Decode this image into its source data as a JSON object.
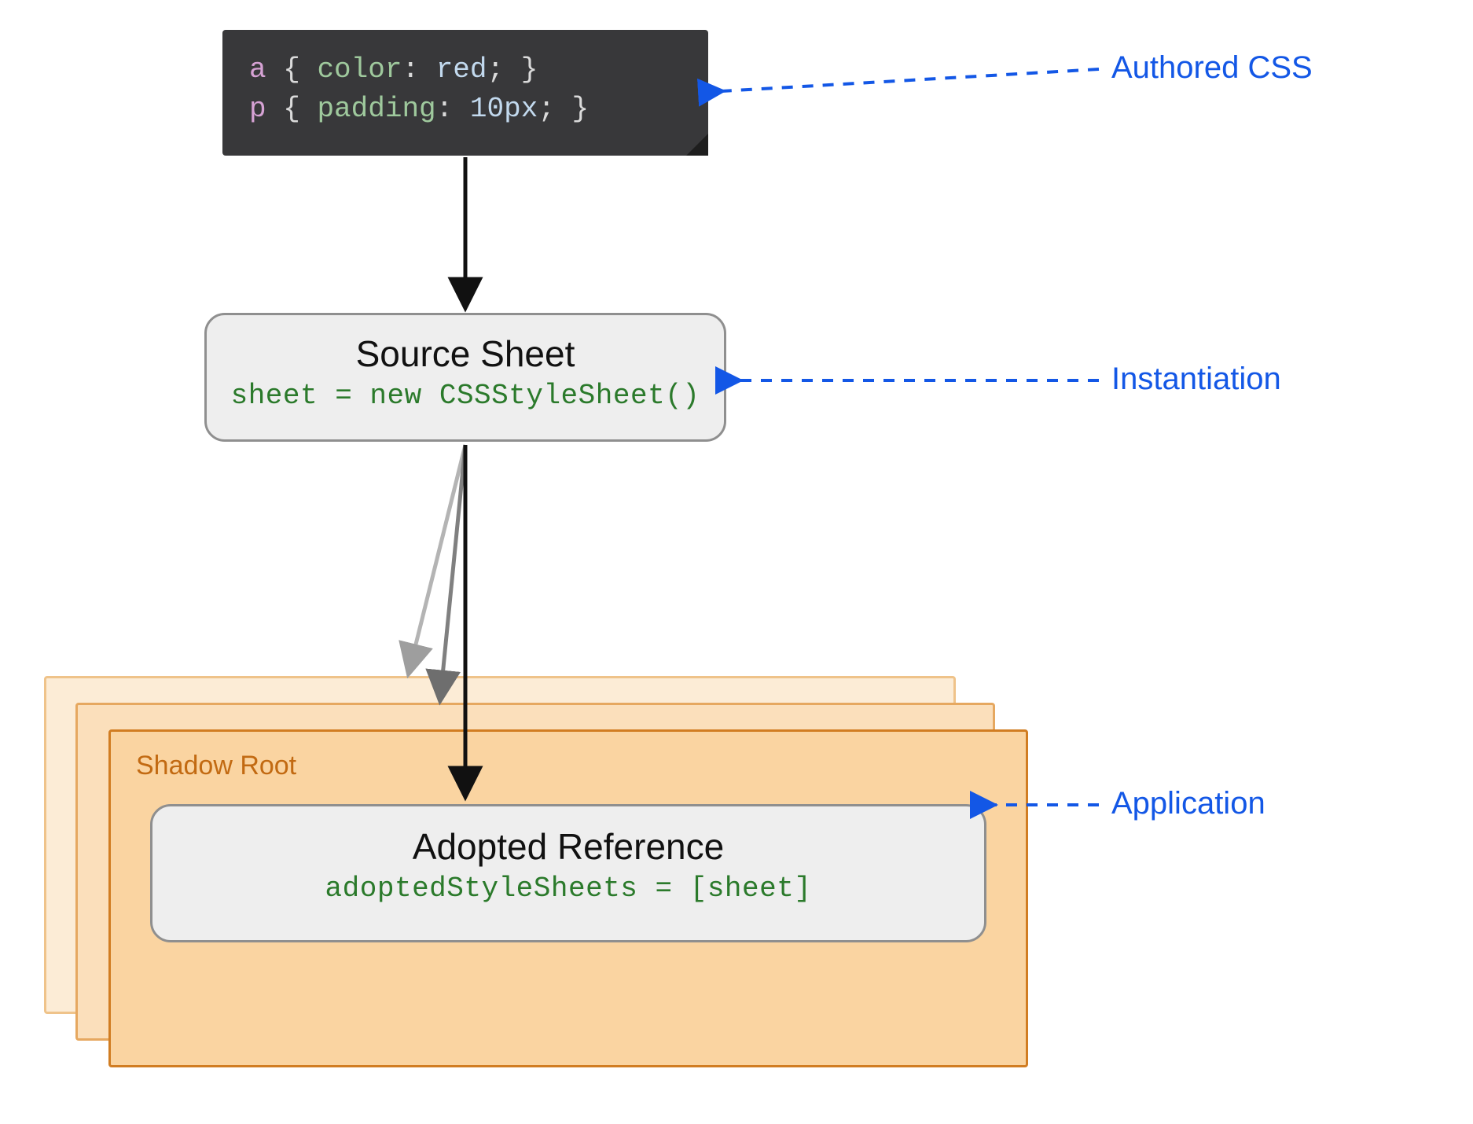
{
  "code_block": {
    "lines": [
      {
        "selector": "a",
        "brace_open": "{",
        "property": "color",
        "colon": ":",
        "value": "red",
        "semi": ";",
        "brace_close": "}"
      },
      {
        "selector": "p",
        "brace_open": "{",
        "property": "padding",
        "colon": ":",
        "value": "10px",
        "semi": ";",
        "brace_close": "}"
      }
    ]
  },
  "source_sheet": {
    "title": "Source Sheet",
    "code": "sheet = new CSSStyleSheet()"
  },
  "shadow_root": {
    "label": "Shadow Root"
  },
  "adopted": {
    "title": "Adopted Reference",
    "code": "adoptedStyleSheets = [sheet]"
  },
  "annotations": {
    "authored": "Authored CSS",
    "instantiation": "Instantiation",
    "application": "Application"
  }
}
